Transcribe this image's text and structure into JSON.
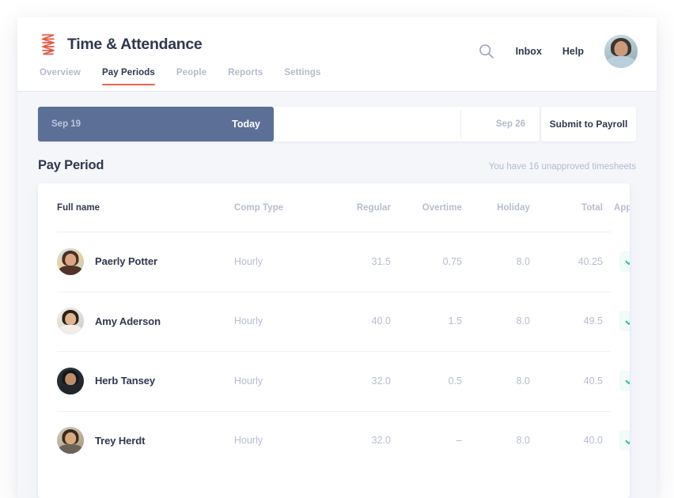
{
  "brand": {
    "logo_icon": "zigzag-z-logo-icon",
    "logo_color": "#e8573f",
    "title": "Time & Attendance"
  },
  "nav": {
    "tabs": [
      {
        "label": "Overview",
        "active": false
      },
      {
        "label": "Pay Periods",
        "active": true
      },
      {
        "label": "People",
        "active": false
      },
      {
        "label": "Reports",
        "active": false
      },
      {
        "label": "Settings",
        "active": false
      }
    ],
    "active_underline_color": "#f06449"
  },
  "header_right": {
    "search_icon": "search-icon",
    "inbox_label": "Inbox",
    "help_label": "Help",
    "avatar_alt": "user-avatar"
  },
  "period_bar": {
    "start_date": "Sep 19",
    "today_label": "Today",
    "end_date": "Sep 26",
    "submit_label": "Submit to Payroll",
    "fill_color": "#5c6f97",
    "progress_percent": 47
  },
  "section": {
    "title": "Pay Period",
    "note": "You have 16 unapproved timesheets",
    "unapproved_count": 16
  },
  "table": {
    "columns": [
      "Full name",
      "Comp Type",
      "Regular",
      "Overtime",
      "Holiday",
      "Total",
      "Approve"
    ],
    "approve_icon": "check-icon",
    "approve_color": "#2ec08c",
    "rows": [
      {
        "name": "Paerly Potter",
        "comp_type": "Hourly",
        "regular": "31.5",
        "overtime": "0.75",
        "holiday": "8.0",
        "total": "40.25",
        "approved": true
      },
      {
        "name": "Amy Aderson",
        "comp_type": "Hourly",
        "regular": "40.0",
        "overtime": "1.5",
        "holiday": "8.0",
        "total": "49.5",
        "approved": true
      },
      {
        "name": "Herb Tansey",
        "comp_type": "Hourly",
        "regular": "32.0",
        "overtime": "0.5",
        "holiday": "8.0",
        "total": "40.5",
        "approved": true
      },
      {
        "name": "Trey Herdt",
        "comp_type": "Hourly",
        "regular": "32.0",
        "overtime": "–",
        "holiday": "8.0",
        "total": "40.0",
        "approved": true
      }
    ]
  }
}
